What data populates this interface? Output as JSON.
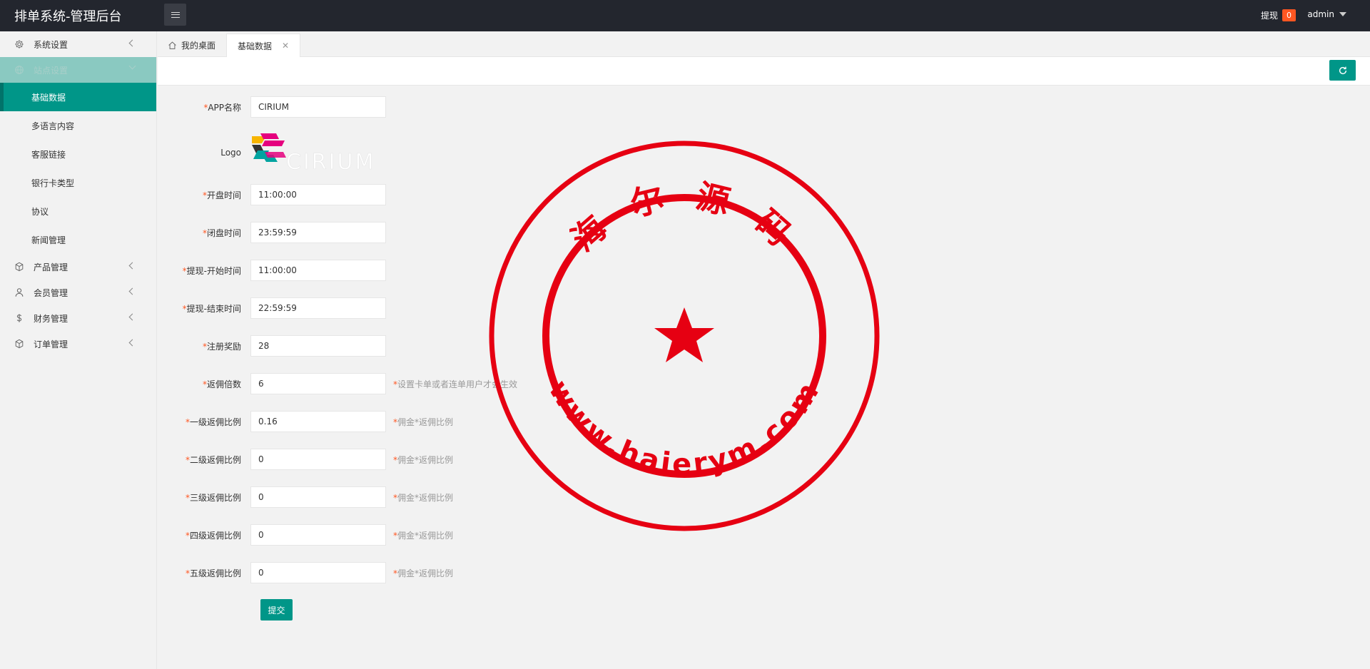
{
  "header": {
    "title": "排单系统-管理后台",
    "withdraw_label": "提现",
    "withdraw_count": "0",
    "user": "admin"
  },
  "sidebar": {
    "items": [
      {
        "label": "系统设置",
        "icon": "gear-icon"
      },
      {
        "label": "站点设置",
        "icon": "globe-icon"
      },
      {
        "label": "产品管理",
        "icon": "box-icon"
      },
      {
        "label": "会员管理",
        "icon": "user-icon"
      },
      {
        "label": "财务管理",
        "icon": "dollar-icon"
      },
      {
        "label": "订单管理",
        "icon": "box-icon"
      }
    ],
    "sub_items": [
      "基础数据",
      "多语言内容",
      "客服链接",
      "银行卡类型",
      "协议",
      "新闻管理"
    ]
  },
  "tabs": {
    "home": "我的桌面",
    "current": "基础数据",
    "close": "✕"
  },
  "form": {
    "app_name": {
      "label": "APP名称",
      "value": "CIRIUM"
    },
    "logo": {
      "label": "Logo",
      "text": "CIRIUM"
    },
    "open_time": {
      "label": "开盘时间",
      "value": "11:00:00"
    },
    "close_time": {
      "label": "闭盘时间",
      "value": "23:59:59"
    },
    "withdraw_start": {
      "label": "提现-开始时间",
      "value": "11:00:00"
    },
    "withdraw_end": {
      "label": "提现-结束时间",
      "value": "22:59:59"
    },
    "register_bonus": {
      "label": "注册奖励",
      "value": "28"
    },
    "commission_multiple": {
      "label": "返佣倍数",
      "value": "6",
      "hint": "设置卡单或者连单用户才会生效"
    },
    "level1": {
      "label": "一级返佣比例",
      "value": "0.16",
      "hint": "佣金*返佣比例"
    },
    "level2": {
      "label": "二级返佣比例",
      "value": "0",
      "hint": "佣金*返佣比例"
    },
    "level3": {
      "label": "三级返佣比例",
      "value": "0",
      "hint": "佣金*返佣比例"
    },
    "level4": {
      "label": "四级返佣比例",
      "value": "0",
      "hint": "佣金*返佣比例"
    },
    "level5": {
      "label": "五级返佣比例",
      "value": "0",
      "hint": "佣金*返佣比例"
    },
    "required_mark": "*",
    "submit_label": "提交"
  },
  "watermark": {
    "top_text": "海 尔 源 码",
    "bottom_text": "www.haierym.com",
    "color": "#e60012"
  },
  "colors": {
    "accent": "#009688",
    "header_bg": "#23262e",
    "badge": "#ff5722"
  }
}
